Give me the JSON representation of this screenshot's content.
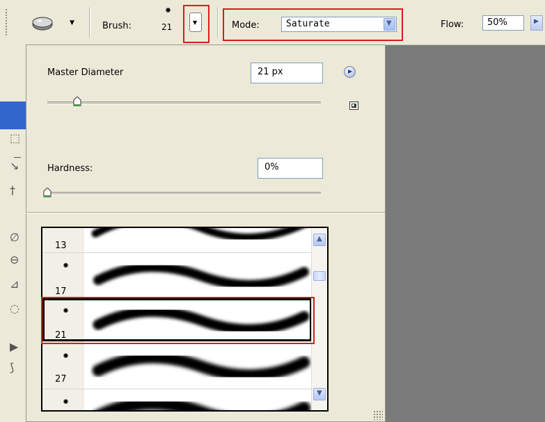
{
  "options_bar": {
    "brush_label": "Brush:",
    "brush_size": "21",
    "mode_label": "Mode:",
    "mode_value": "Saturate",
    "flow_label": "Flow:",
    "flow_value": "50%",
    "tool_icon": "sponge-tool-icon"
  },
  "brush_panel": {
    "master_diameter_label": "Master Diameter",
    "master_diameter_value": "21 px",
    "master_diameter_slider": 0.1,
    "hardness_label": "Hardness:",
    "hardness_value": "0%",
    "hardness_slider": 0.0,
    "menu_icon": "panel-menu-arrow-icon",
    "new_preset_icon": "new-preset-icon"
  },
  "brush_list": {
    "items": [
      {
        "size": "13"
      },
      {
        "size": "17"
      },
      {
        "size": "21",
        "selected": true
      },
      {
        "size": "27"
      }
    ]
  },
  "colors": {
    "highlight": "#d61c1c",
    "panel_bg": "#ece9d8",
    "canvas_bg": "#7a7a7a"
  }
}
